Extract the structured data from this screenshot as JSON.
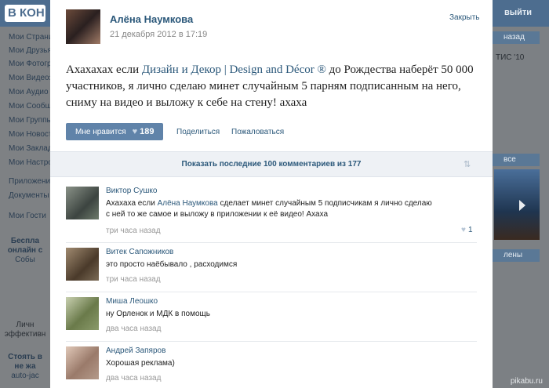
{
  "background": {
    "logo": "В КОН",
    "exit": "выйти",
    "menu": [
      "Мои Страни",
      "Мои Друзья",
      "Мои Фотогр",
      "Мои Видеоз",
      "Мои Аудио",
      "Мои Сообщ",
      "Мои Группы",
      "Мои Новост",
      "Мои Заклад",
      "Мои Настро",
      "Приложени",
      "Документы",
      "Мои Гости"
    ],
    "promo1": [
      "Беспла",
      "онлайн с",
      "Собы"
    ],
    "promo2": [
      "Личн",
      "эффективн"
    ],
    "promo3": [
      "Стоять в",
      "не жа",
      "auto-jac"
    ],
    "right_buttons": [
      "назад",
      "все",
      "лены"
    ],
    "right_text": "ТИС '10",
    "watermark": "pikabu.ru"
  },
  "post": {
    "author": "Алёна Наумкова",
    "date": "21 декабря 2012 в 17:19",
    "close": "Закрыть",
    "text_before": "Ахахахах если ",
    "text_link": "Дизайн и Декор | Design and Décor ®",
    "text_after": " до Рождества наберёт 50 000 участников, я лично сделаю минет случайным 5 парням подписанным на него, сниму на видео и выложу к себе на стену! ахаха",
    "like_label": "Мне нравится",
    "like_icon": "heart-icon",
    "like_count": "189",
    "share": "Поделиться",
    "report": "Пожаловаться"
  },
  "show_comments": "Показать последние 100 комментариев из 177",
  "sort_icon": "sort-arrows-icon",
  "comments": [
    {
      "author": "Виктор Сушко",
      "text_before": "Ахахаха если ",
      "text_link": "Алёна Наумкова",
      "text_after": " сделает минет случайным 5 подписчикам я лично сделаю с ней то же самое и выложу в приложении к её видео! Ахаха",
      "time": "три часа назад",
      "likes": "1",
      "avatar_color": "#6d7a6a"
    },
    {
      "author": "Витек Сапожников",
      "text_before": "это просто наёбывало , расходимся",
      "text_link": "",
      "text_after": "",
      "time": "три часа назад",
      "likes": "",
      "avatar_color": "#7a6a55"
    },
    {
      "author": "Миша Леошко",
      "text_before": "ну Орленок и МДК в помощь",
      "text_link": "",
      "text_after": "",
      "time": "два часа назад",
      "likes": "",
      "avatar_color": "#8a9a6a"
    },
    {
      "author": "Андрей Запяров",
      "text_before": "Хорошая реклама)",
      "text_link": "",
      "text_after": "",
      "time": "два часа назад",
      "likes": "",
      "avatar_color": "#b49a8a"
    }
  ]
}
